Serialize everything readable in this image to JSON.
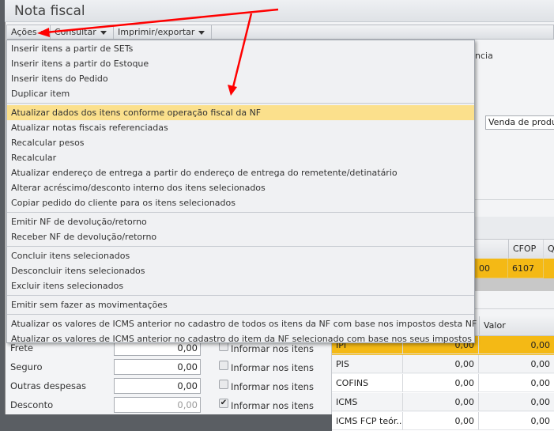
{
  "window": {
    "title": "Nota fiscal"
  },
  "toolbar": {
    "acoes": "Ações",
    "consultar": "Consultar",
    "imprimir": "Imprimir/exportar"
  },
  "menu": {
    "groups": [
      [
        "Inserir itens a partir de SETs",
        "Inserir itens a partir do Estoque",
        "Inserir itens do Pedido",
        "Duplicar item"
      ],
      [
        "Atualizar dados dos itens conforme operação fiscal da NF",
        "Atualizar notas fiscais referenciadas",
        "Recalcular pesos",
        "Recalcular",
        "Atualizar endereço de entrega a partir do endereço de entrega do remetente/detinatário",
        "Alterar acréscimo/desconto interno dos itens selecionados",
        "Copiar pedido do cliente para os itens selecionados"
      ],
      [
        "Emitir NF de devolução/retorno",
        "Receber NF de devolução/retorno"
      ],
      [
        "Concluir itens selecionados",
        "Desconcluir itens selecionados",
        "Excluir itens selecionados"
      ],
      [
        "Emitir sem fazer as movimentações"
      ],
      [
        "Atualizar os valores de ICMS anterior no cadastro de todos os itens da NF com base nos impostos desta NF",
        "Atualizar os valores de ICMS anterior no cadastro do item da NF selecionado com base nos seus impostos"
      ]
    ],
    "highlighted": "Atualizar dados dos itens conforme operação fiscal da NF"
  },
  "background": {
    "partial_label": "ncia",
    "operation_field": "Venda de produ",
    "items_grid": {
      "headers": [
        "CFOP",
        "Q"
      ],
      "selected_row": {
        "partial": "00",
        "cfop": "6107"
      }
    },
    "tax_grid": {
      "header_valor": "Valor",
      "rows": [
        {
          "name": "IPI",
          "base": "0,00",
          "valor": "0,00"
        },
        {
          "name": "PIS",
          "base": "0,00",
          "valor": "0,00"
        },
        {
          "name": "COFINS",
          "base": "0,00",
          "valor": "0,00"
        },
        {
          "name": "ICMS",
          "base": "0,00",
          "valor": "0,00"
        },
        {
          "name": "ICMS FCP teór...",
          "base": "0,00",
          "valor": "0,00"
        }
      ]
    },
    "totals": [
      {
        "label": "Frete",
        "value": "0,00",
        "informar": "Informar nos itens",
        "checked": false
      },
      {
        "label": "Seguro",
        "value": "0,00",
        "informar": "Informar nos itens",
        "checked": false
      },
      {
        "label": "Outras despesas",
        "value": "0,00",
        "informar": "Informar nos itens",
        "checked": false
      },
      {
        "label": "Desconto",
        "value": "0,00",
        "informar": "Informar nos itens",
        "checked": true
      }
    ]
  },
  "colors": {
    "highlight": "#fbe08c",
    "selected_row": "#f4b915",
    "arrow": "#ff0000"
  }
}
